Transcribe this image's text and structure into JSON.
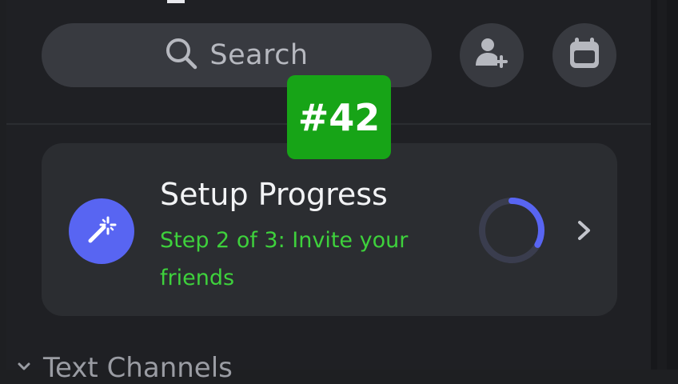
{
  "search": {
    "label": "Search",
    "icon": "search-icon"
  },
  "header_actions": {
    "add_friend_icon": "add-friend-icon",
    "events_icon": "calendar-icon"
  },
  "badge": {
    "label": "#42"
  },
  "setup_card": {
    "icon": "magic-wand-icon",
    "title": "Setup Progress",
    "step": "Step 2 of 3: Invite your friends",
    "progress": 0.33,
    "chevron_icon": "chevron-right-icon"
  },
  "section": {
    "label": "Text Channels",
    "icon": "chevron-down-icon"
  },
  "colors": {
    "accent": "#5865f2",
    "success_green": "#3ed13c",
    "badge_green": "#17a417",
    "background": "#1f2024",
    "surface": "#2b2d31",
    "input": "#383a40"
  }
}
